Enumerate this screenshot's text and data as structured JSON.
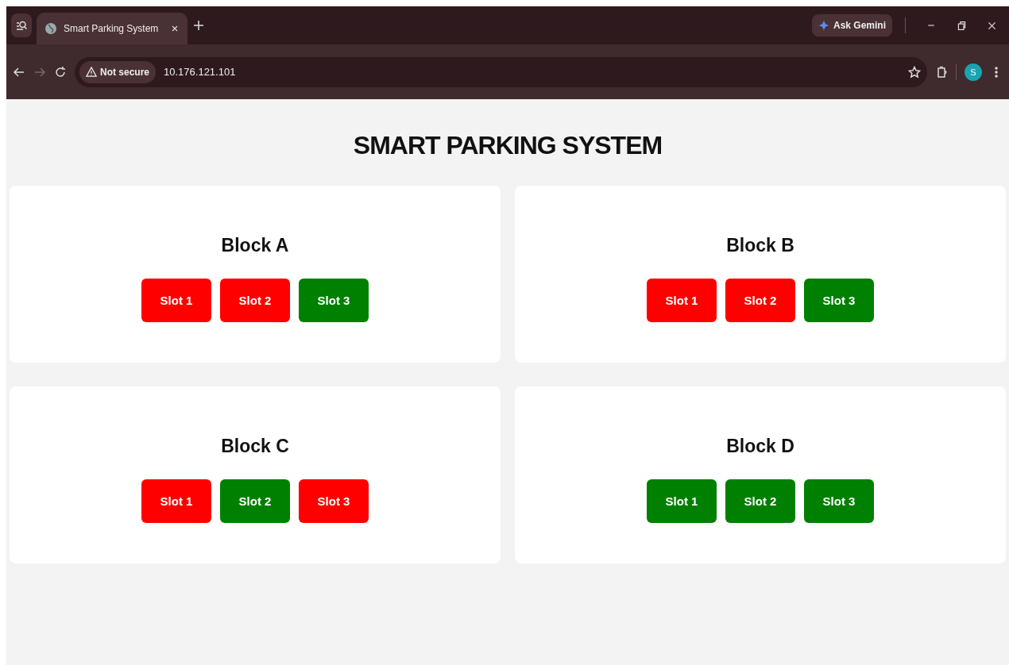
{
  "browser": {
    "tab_title": "Smart Parking System",
    "ask_button": "Ask Gemini",
    "security_label": "Not secure",
    "url": "10.176.121.101",
    "profile_initial": "S"
  },
  "page": {
    "title": "SMART PARKING SYSTEM",
    "blocks": [
      {
        "name": "Block A",
        "slots": [
          {
            "label": "Slot 1",
            "occupied": true
          },
          {
            "label": "Slot 2",
            "occupied": true
          },
          {
            "label": "Slot 3",
            "occupied": false
          }
        ]
      },
      {
        "name": "Block B",
        "slots": [
          {
            "label": "Slot 1",
            "occupied": true
          },
          {
            "label": "Slot 2",
            "occupied": true
          },
          {
            "label": "Slot 3",
            "occupied": false
          }
        ]
      },
      {
        "name": "Block C",
        "slots": [
          {
            "label": "Slot 1",
            "occupied": true
          },
          {
            "label": "Slot 2",
            "occupied": false
          },
          {
            "label": "Slot 3",
            "occupied": true
          }
        ]
      },
      {
        "name": "Block D",
        "slots": [
          {
            "label": "Slot 1",
            "occupied": false
          },
          {
            "label": "Slot 2",
            "occupied": false
          },
          {
            "label": "Slot 3",
            "occupied": false
          }
        ]
      }
    ]
  }
}
